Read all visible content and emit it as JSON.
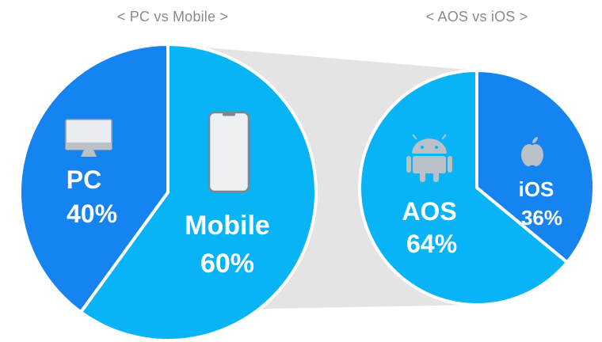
{
  "colors": {
    "pc": "#1584f0",
    "mobile": "#09b4f6",
    "aos": "#09b4f6",
    "ios": "#1584f0",
    "connector": "#e4e4e4",
    "separator": "#ffffff",
    "title": "#8a8a8a"
  },
  "chart_data": [
    {
      "type": "pie",
      "title": "< PC vs Mobile >",
      "slices": [
        {
          "key": "pc",
          "label": "PC",
          "value": 40,
          "value_label": "40%",
          "icon": "monitor-icon"
        },
        {
          "key": "mobile",
          "label": "Mobile",
          "value": 60,
          "value_label": "60%",
          "icon": "smartphone-icon"
        }
      ]
    },
    {
      "type": "pie",
      "title": "< AOS vs iOS >",
      "slices": [
        {
          "key": "aos",
          "label": "AOS",
          "value": 64,
          "value_label": "64%",
          "icon": "android-icon"
        },
        {
          "key": "ios",
          "label": "iOS",
          "value": 36,
          "value_label": "36%",
          "icon": "apple-icon"
        }
      ]
    }
  ]
}
